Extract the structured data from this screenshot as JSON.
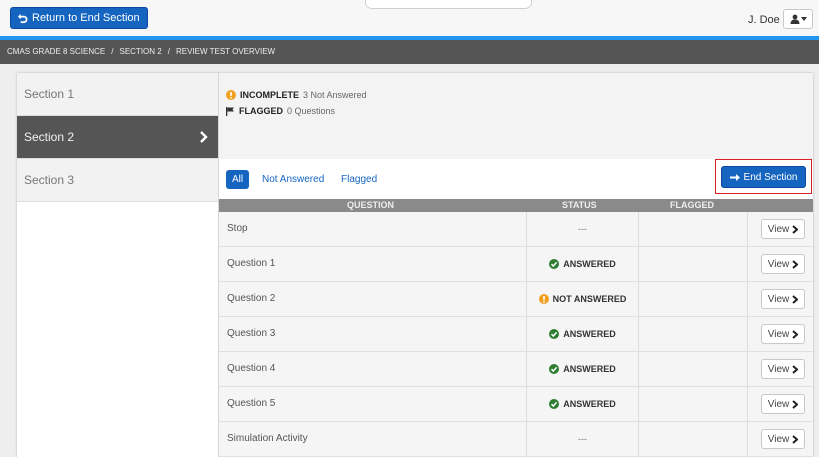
{
  "topbar": {
    "return_label": "Return to End Section",
    "user_name": "J. Doe"
  },
  "breadcrumb": {
    "items": [
      "CMAS GRADE 8 SCIENCE",
      "SECTION 2",
      "REVIEW TEST OVERVIEW"
    ],
    "separator": "/"
  },
  "sidebar": {
    "items": [
      {
        "label": "Section 1",
        "active": false
      },
      {
        "label": "Section 2",
        "active": true
      },
      {
        "label": "Section 3",
        "active": false
      }
    ]
  },
  "summary": {
    "incomplete_label": "INCOMPLETE",
    "incomplete_detail": "3 Not Answered",
    "flagged_label": "FLAGGED",
    "flagged_detail": "0 Questions"
  },
  "filters": {
    "all": "All",
    "not_answered": "Not Answered",
    "flagged": "Flagged"
  },
  "end_section_label": "End Section",
  "table": {
    "headers": {
      "question": "QUESTION",
      "status": "STATUS",
      "flagged": "FLAGGED"
    },
    "view_label": "View",
    "rows": [
      {
        "question": "Stop",
        "status": "---",
        "status_type": "none"
      },
      {
        "question": "Question 1",
        "status": "ANSWERED",
        "status_type": "answered"
      },
      {
        "question": "Question 2",
        "status": "NOT ANSWERED",
        "status_type": "not_answered"
      },
      {
        "question": "Question 3",
        "status": "ANSWERED",
        "status_type": "answered"
      },
      {
        "question": "Question 4",
        "status": "ANSWERED",
        "status_type": "answered"
      },
      {
        "question": "Question 5",
        "status": "ANSWERED",
        "status_type": "answered"
      },
      {
        "question": "Simulation Activity",
        "status": "---",
        "status_type": "none"
      }
    ]
  },
  "icons": {
    "return": "return-arrow-icon",
    "user": "user-icon",
    "caret": "caret-down-icon",
    "warning": "exclamation-circle-icon",
    "flag": "flag-icon",
    "check": "check-circle-icon",
    "arrow_right": "arrow-right-icon",
    "chevron_right": "chevron-right-icon"
  },
  "colors": {
    "primary": "#1565c0",
    "accent_line": "#2196f3",
    "answered": "#2e7d32",
    "not_answered": "#f0a020",
    "highlight_outline": "#d62020",
    "dark_bar": "#555555"
  }
}
